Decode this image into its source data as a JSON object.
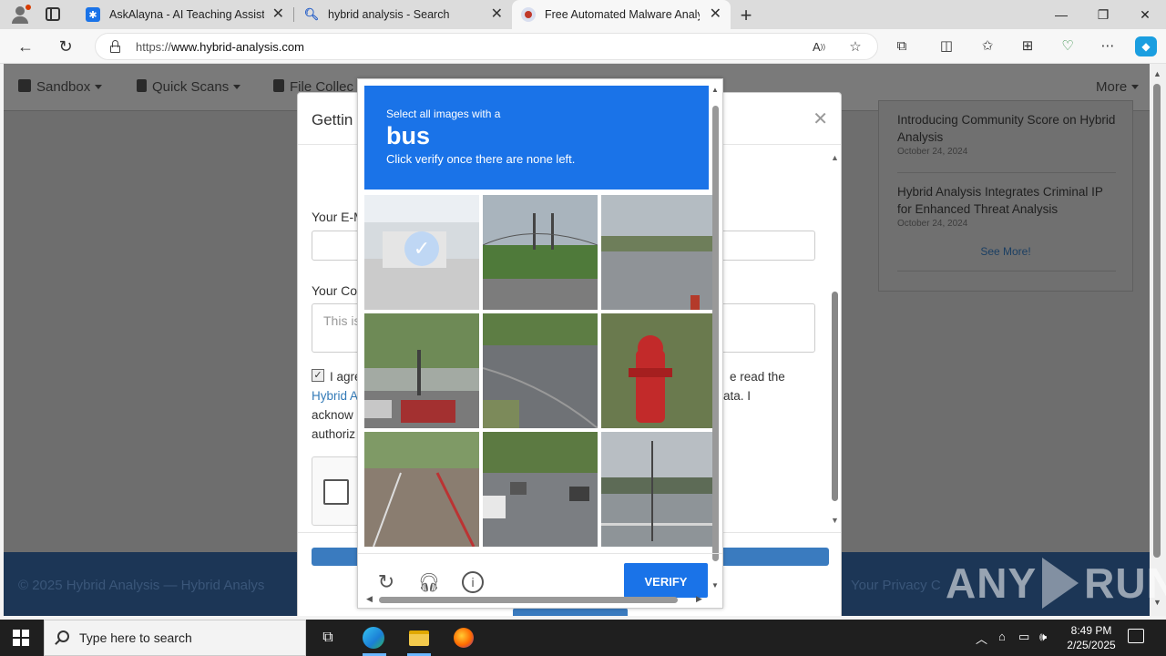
{
  "browser": {
    "tabs": [
      {
        "label": "AskAlayna - AI Teaching Assistan",
        "favicon": "asterisk-icon",
        "active": false
      },
      {
        "label": "hybrid analysis - Search",
        "favicon": "search-icon",
        "active": false
      },
      {
        "label": "Free Automated Malware Analysis",
        "favicon": "hybrid-analysis-icon",
        "active": true
      }
    ],
    "url_prefix": "https://",
    "url_domain": "www.hybrid-analysis.com"
  },
  "site": {
    "nav": {
      "sandbox": "Sandbox",
      "quick_scans": "Quick Scans",
      "file_collections": "File Collec",
      "more": "More"
    },
    "news": [
      {
        "title": "Introducing Community Score on Hybrid Analysis",
        "date": "October 24, 2024"
      },
      {
        "title": "Hybrid Analysis Integrates Criminal IP for Enhanced Threat Analysis",
        "date": "October 24, 2024"
      }
    ],
    "see_more": "See More!",
    "footer_left": "© 2025 Hybrid Analysis — Hybrid Analys",
    "footer_right": "Your Privacy C"
  },
  "modal": {
    "title": "Gettin",
    "email_label": "Your E-M",
    "comment_label": "Your Co",
    "comment_placeholder": "This is",
    "agree_checked": true,
    "agree_line1_start": "I agre",
    "agree_line1_end": "e read the",
    "agree_link": "Hybrid A",
    "agree_line2_end": "ata. I",
    "agree_line3": "acknow",
    "agree_line4": "authoriz"
  },
  "captcha": {
    "instruction_small": "Select all images with a",
    "target": "bus",
    "instruction_sub": "Click verify once there are none left.",
    "verify_label": "VERIFY",
    "tiles": [
      {
        "scene": "street with vehicle",
        "selected": true
      },
      {
        "scene": "suspension bridge with trees",
        "selected": false
      },
      {
        "scene": "river bank",
        "selected": false
      },
      {
        "scene": "intersection with traffic lights and cars",
        "selected": false
      },
      {
        "scene": "road curve with trees",
        "selected": false
      },
      {
        "scene": "red fire hydrant",
        "selected": false
      },
      {
        "scene": "road with bike lane",
        "selected": false
      },
      {
        "scene": "street with parked cars",
        "selected": false
      },
      {
        "scene": "waterfront with railing",
        "selected": false
      }
    ]
  },
  "watermark": {
    "left": "ANY",
    "right": "RUN"
  },
  "taskbar": {
    "search_placeholder": "Type here to search",
    "time": "8:49 PM",
    "date": "2/25/2025"
  }
}
